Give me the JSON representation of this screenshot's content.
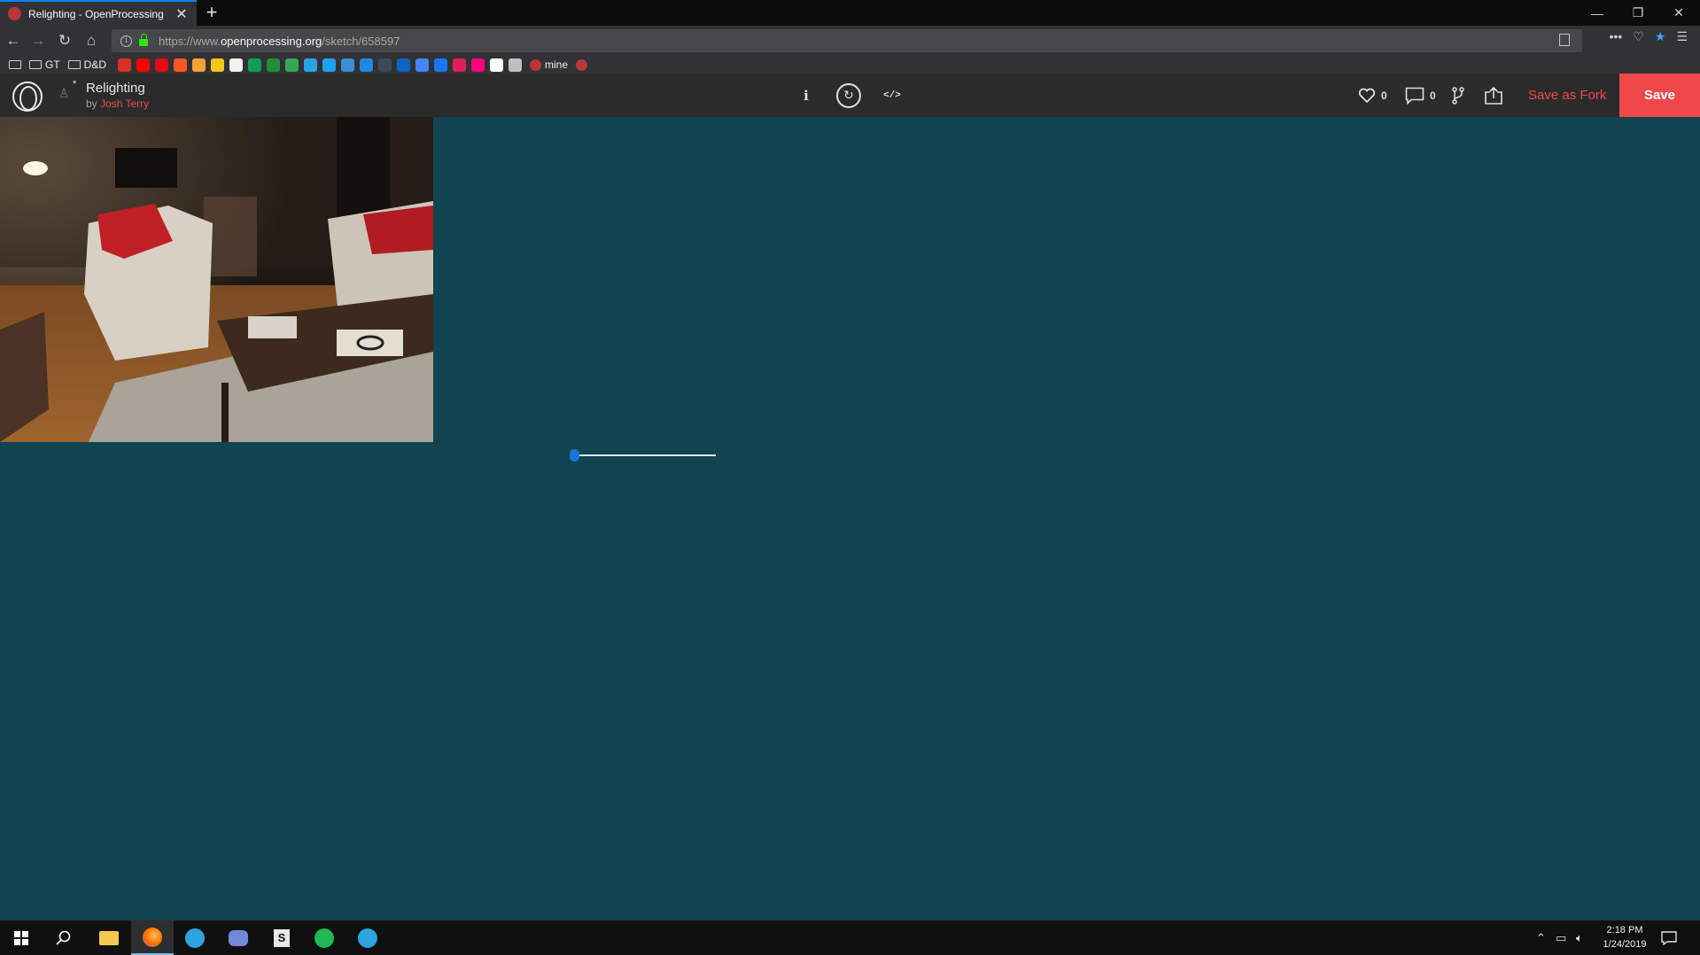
{
  "browser": {
    "tab_title": "Relighting - OpenProcessing",
    "url_prefix": "https://www.",
    "url_host": "openprocessing.org",
    "url_path": "/sketch/658597",
    "bookmarks": {
      "folders": [
        "GT",
        "D&D"
      ],
      "mine_label": "mine",
      "icons": [
        {
          "name": "gmail-icon",
          "color": "#d93025"
        },
        {
          "name": "youtube-icon",
          "color": "#ff0000"
        },
        {
          "name": "netflix-icon",
          "color": "#e50914"
        },
        {
          "name": "bookmark-orange-icon",
          "color": "#ff5722"
        },
        {
          "name": "bookmark-multicolor-icon",
          "color": "#f4a13b"
        },
        {
          "name": "chrome-yellow-icon",
          "color": "#f5c518"
        },
        {
          "name": "amazon-icon",
          "color": "#f0f0f0"
        },
        {
          "name": "hangouts-icon",
          "color": "#0f9d58"
        },
        {
          "name": "sheets-icon",
          "color": "#1e8e3e"
        },
        {
          "name": "green-leaf-icon",
          "color": "#34a853"
        },
        {
          "name": "telegram-icon",
          "color": "#2aa3e0"
        },
        {
          "name": "twitter-icon",
          "color": "#1da1f2"
        },
        {
          "name": "box-icon",
          "color": "#3b8fd6"
        },
        {
          "name": "blue-app-icon",
          "color": "#1e88e5"
        },
        {
          "name": "dark-app-icon",
          "color": "#3b4a5a"
        },
        {
          "name": "linkedin-icon",
          "color": "#0a66c2"
        },
        {
          "name": "calendar-icon",
          "color": "#4285f4"
        },
        {
          "name": "facebook-icon",
          "color": "#1877f2"
        },
        {
          "name": "slack-icon",
          "color": "#e01e5a"
        },
        {
          "name": "flickr-icon",
          "color": "#ff0084"
        },
        {
          "name": "google-icon",
          "color": "#ffffff"
        },
        {
          "name": "globe-icon",
          "color": "#c0c0c0"
        }
      ]
    }
  },
  "sketch": {
    "title": "Relighting",
    "by": "by ",
    "author": "Josh Terry",
    "likes": "0",
    "comments": "0",
    "save_as_fork": "Save as Fork",
    "save": "Save",
    "slider_value": 0.0
  },
  "taskbar": {
    "time": "2:18 PM",
    "date": "1/24/2019"
  },
  "colors": {
    "canvas_bg": "#0f4450",
    "accent_red": "#f0474b",
    "slider_thumb": "#1976d2"
  }
}
